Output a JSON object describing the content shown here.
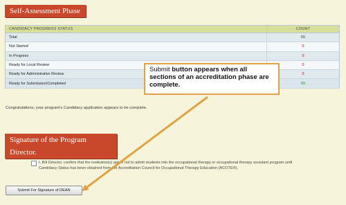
{
  "phase_header": "Self-Assessment Phase",
  "status_table": {
    "col_status": "CANDIDACY PROGRESS STATUS",
    "col_count": "COUNT",
    "rows": [
      {
        "label": "Total",
        "count": "50",
        "count_color": "black"
      },
      {
        "label": "Not Started",
        "count": "0",
        "count_color": "red"
      },
      {
        "label": "In Progress",
        "count": "0",
        "count_color": "red"
      },
      {
        "label": "Ready for Local Review",
        "count": "0",
        "count_color": "red"
      },
      {
        "label": "Ready for Administrative Review",
        "count": "0",
        "count_color": "red"
      },
      {
        "label": "Ready for Submission/Completed",
        "count": "50",
        "count_color": "green"
      }
    ]
  },
  "congrats_text": "Congratulations, your program's Candidacy application appears to be complete.",
  "callout": {
    "bold_word": "Submit",
    "text": "button appears when all sections of an accreditation phase are complete."
  },
  "signature_header": "Signature of the Program Director.",
  "signature": {
    "statement": "I, Bill Director, confirm that the institution(s) agree not to admit students into the occupational therapy or occupational therapy assistant program until Candidacy Status has been obtained from the Accreditation Council for Occupational Therapy Education (ACOTE®)."
  },
  "submit_button_label": "Submit For Signature of DEAN",
  "colors": {
    "header_bg": "#c9472a",
    "callout_border": "#e0a243",
    "arrow": "#e0a243",
    "page_bg": "#f6f5dc"
  }
}
